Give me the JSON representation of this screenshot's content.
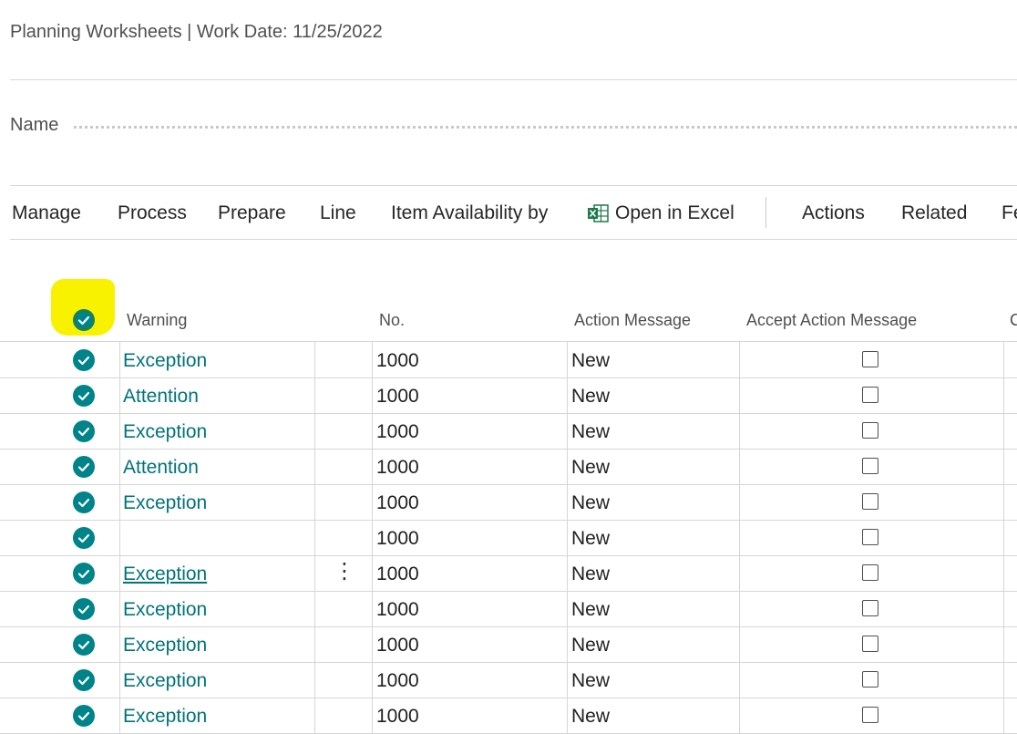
{
  "page": {
    "title": "Planning Worksheets | Work Date: 11/25/2022",
    "name_label": "Name"
  },
  "actionbar": {
    "items": [
      "Manage",
      "Process",
      "Prepare",
      "Line",
      "Item Availability by"
    ],
    "excel_label": "Open in Excel",
    "actions_label": "Actions",
    "related_label": "Related",
    "more_label": "Fe"
  },
  "columns": {
    "warning": "Warning",
    "no": "No.",
    "action_message": "Action Message",
    "accept_action_message": "Accept Action Message",
    "next": "C"
  },
  "colors": {
    "accent": "#008489",
    "link": "#00747a",
    "highlight": "#f8f200"
  },
  "rows": [
    {
      "warning": "Exception",
      "no": "1000",
      "action": "New",
      "accepted": false
    },
    {
      "warning": "Attention",
      "no": "1000",
      "action": "New",
      "accepted": false
    },
    {
      "warning": "Exception",
      "no": "1000",
      "action": "New",
      "accepted": false
    },
    {
      "warning": "Attention",
      "no": "1000",
      "action": "New",
      "accepted": false
    },
    {
      "warning": "Exception",
      "no": "1000",
      "action": "New",
      "accepted": false
    },
    {
      "warning": "",
      "no": "1000",
      "action": "New",
      "accepted": false
    },
    {
      "warning": "Exception",
      "no": "1000",
      "action": "New",
      "accepted": false,
      "focused": true
    },
    {
      "warning": "Exception",
      "no": "1000",
      "action": "New",
      "accepted": false
    },
    {
      "warning": "Exception",
      "no": "1000",
      "action": "New",
      "accepted": false
    },
    {
      "warning": "Exception",
      "no": "1000",
      "action": "New",
      "accepted": false
    },
    {
      "warning": "Exception",
      "no": "1000",
      "action": "New",
      "accepted": false
    }
  ]
}
